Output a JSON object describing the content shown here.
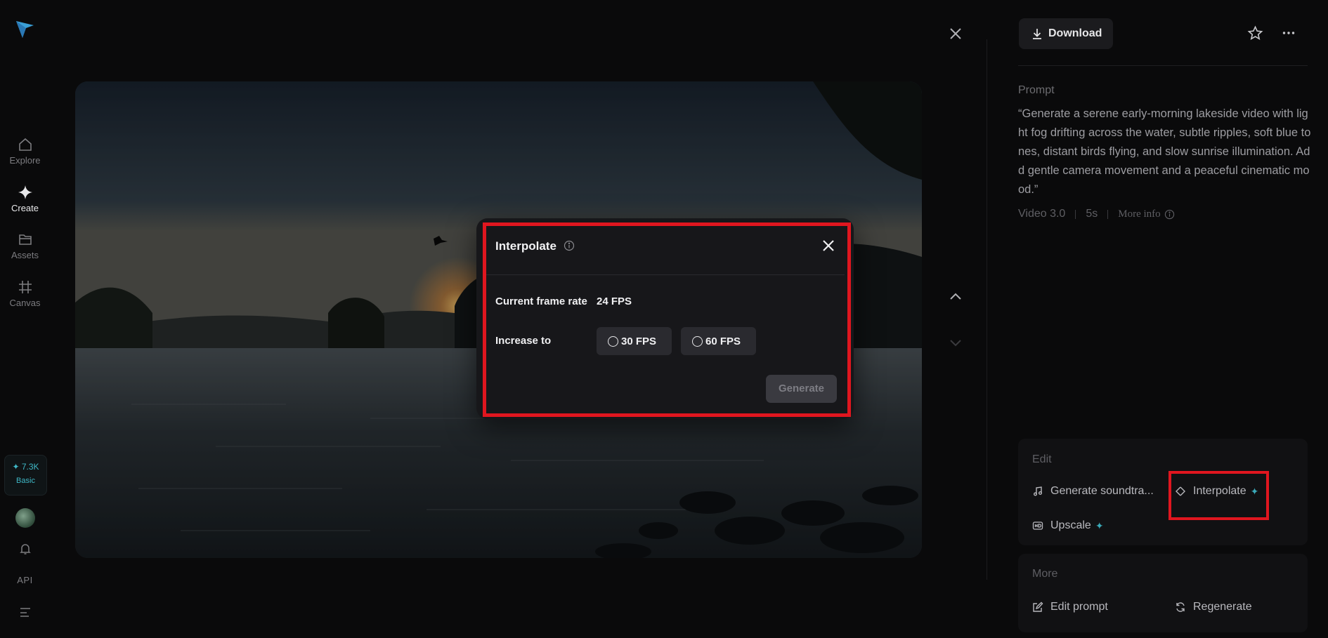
{
  "sidebar": {
    "logo": "brand-logo",
    "items": [
      {
        "label": "Explore",
        "icon": "home-icon"
      },
      {
        "label": "Create",
        "icon": "sparkle-icon"
      },
      {
        "label": "Assets",
        "icon": "folder-icon"
      },
      {
        "label": "Canvas",
        "icon": "canvas-icon"
      }
    ],
    "credits": {
      "amount": "✦ 7.3K",
      "plan": "Basic"
    },
    "api_label": "API"
  },
  "viewer": {
    "close_icon": "close-icon",
    "up_icon": "chevron-up-icon",
    "down_icon": "chevron-down-icon"
  },
  "modal": {
    "title": "Interpolate",
    "current_label": "Current frame rate",
    "current_value": "24 FPS",
    "increase_label": "Increase to",
    "options": [
      "30 FPS",
      "60 FPS"
    ],
    "generate_label": "Generate"
  },
  "panel": {
    "download_label": "Download",
    "prompt_heading": "Prompt",
    "prompt_text": "“Generate a serene early-morning lakeside video with light fog drifting across the water, subtle ripples, soft blue tones, distant birds flying, and slow sunrise illumination. Add gentle camera movement and a peaceful cinematic mood.”",
    "meta": {
      "model": "Video 3.0",
      "duration": "5s",
      "more_info": "More info"
    },
    "edit": {
      "heading": "Edit",
      "items": [
        "Generate soundtra...",
        "Interpolate",
        "Upscale"
      ]
    },
    "more": {
      "heading": "More",
      "items": [
        "Edit prompt",
        "Regenerate"
      ]
    }
  },
  "colors": {
    "accent": "#3aa9b8",
    "highlight": "#e0161f",
    "background": "#0a0a0b"
  }
}
